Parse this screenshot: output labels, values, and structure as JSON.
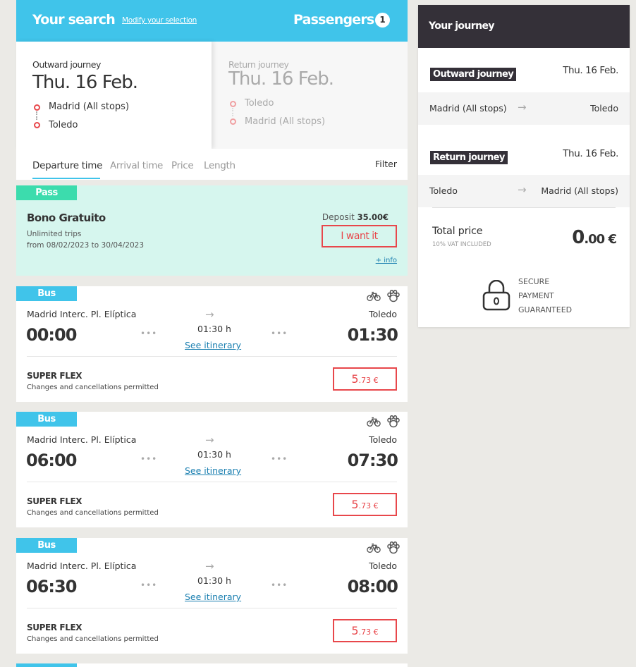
{
  "search": {
    "title": "Your search",
    "modify": "Modify your selection",
    "passengers_label": "Passengers",
    "passengers_count": "1"
  },
  "outward": {
    "label": "Outward journey",
    "date": "Thu. 16 Feb.",
    "from": "Madrid (All stops)",
    "to": "Toledo"
  },
  "return": {
    "label": "Return journey",
    "date": "Thu. 16 Feb.",
    "from": "Toledo",
    "to": "Madrid (All stops)"
  },
  "tabs": [
    "Departure time",
    "Arrival time",
    "Price",
    "Length"
  ],
  "filter": "Filter",
  "pass": {
    "badge": "Pass",
    "name": "Bono Gratuito",
    "line1": "Unlimited trips",
    "line2": "from 08/02/2023 to 30/04/2023",
    "deposit_label": "Deposit",
    "deposit_value": "35.00€",
    "button": "I want it",
    "info": "+ info"
  },
  "trips": [
    {
      "badge": "Bus",
      "from": "Madrid Interc. Pl. Elíptica",
      "to": "Toledo",
      "dep": "00:00",
      "arr": "01:30",
      "duration": "01:30 h",
      "itinerary": "See itinerary",
      "fare": "SUPER FLEX",
      "conditions": "Changes and cancellations permitted",
      "price_int": "5",
      "price_dec": ".73 €"
    },
    {
      "badge": "Bus",
      "from": "Madrid Interc. Pl. Elíptica",
      "to": "Toledo",
      "dep": "06:00",
      "arr": "07:30",
      "duration": "01:30 h",
      "itinerary": "See itinerary",
      "fare": "SUPER FLEX",
      "conditions": "Changes and cancellations permitted",
      "price_int": "5",
      "price_dec": ".73 €"
    },
    {
      "badge": "Bus",
      "from": "Madrid Interc. Pl. Elíptica",
      "to": "Toledo",
      "dep": "06:30",
      "arr": "08:00",
      "duration": "01:30 h",
      "itinerary": "See itinerary",
      "fare": "SUPER FLEX",
      "conditions": "Changes and cancellations permitted",
      "price_int": "5",
      "price_dec": ".73 €"
    }
  ],
  "icons": [
    "bicycle-icon",
    "paw-icon"
  ],
  "summary": {
    "title": "Your journey",
    "outward_tag": "Outward journey",
    "outward_date": "Thu. 16 Feb.",
    "outward_from": "Madrid (All stops)",
    "outward_to": "Toledo",
    "return_tag": "Return journey",
    "return_date": "Thu. 16 Feb.",
    "return_from": "Toledo",
    "return_to": "Madrid (All stops)",
    "total_label": "Total price",
    "vat": "10% VAT INCLUDED",
    "total_int": "0",
    "total_dec": ".00 €",
    "secure_1": "SECURE",
    "secure_2": "PAYMENT",
    "secure_3": "GUARANTEED"
  },
  "colors": {
    "accent": "#40c4ea",
    "pass": "#3cdcad",
    "pass_bg": "#d6f6ee",
    "price": "#e8474b",
    "dark": "#343038"
  }
}
